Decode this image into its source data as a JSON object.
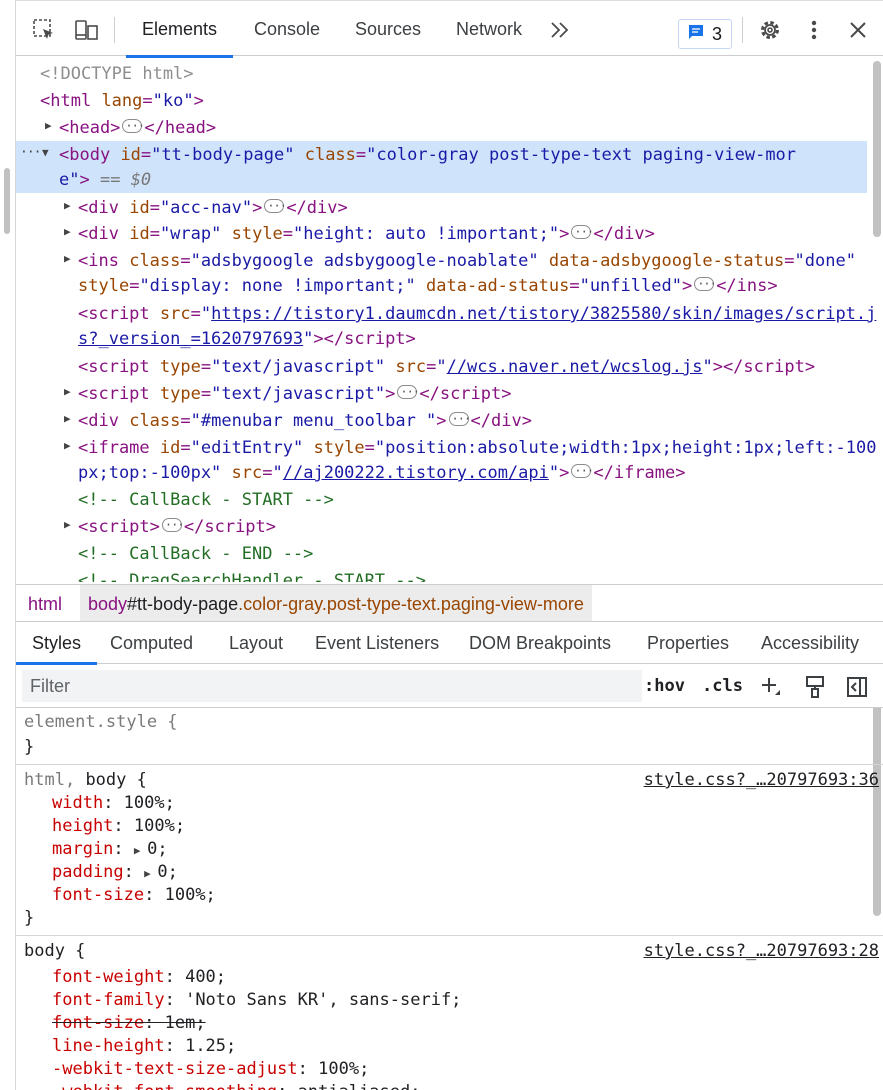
{
  "toolbar": {
    "tabs": [
      {
        "label": "Elements",
        "active": true
      },
      {
        "label": "Console",
        "active": false
      },
      {
        "label": "Sources",
        "active": false
      },
      {
        "label": "Network",
        "active": false
      }
    ],
    "more_label": ">>",
    "issues_count": "3",
    "icons": [
      "inspect-element-icon",
      "device-toggle-icon",
      "chevron-double-right-icon",
      "message-icon",
      "gear-icon",
      "kebab-menu-icon",
      "close-icon"
    ]
  },
  "dom": {
    "doctype": "<!DOCTYPE html>",
    "html_open": "<html",
    "html_lang_attr": "lang",
    "html_lang_val": "\"ko\"",
    "head_open": "<head>",
    "head_close": "</head>",
    "body_open": "<body",
    "body_id_attr": "id",
    "body_id_val": "\"tt-body-page\"",
    "body_class_attr": "class",
    "body_class_val_1": "\"color-gray post-type-text paging-view-mor",
    "body_class_val_2": "e\"",
    "body_eq": "== $0",
    "acc_nav_attr": "id",
    "acc_nav_val": "\"acc-nav\"",
    "wrap_id_val": "\"wrap\"",
    "wrap_style_val": "\"height: auto !important;\"",
    "ins_class_val": "\"adsbygoogle adsbygoogle-noablate\"",
    "ins_status_attr": "data-adsbygoogle-status",
    "ins_status_val": "\"done\"",
    "ins_style_val": "\"display: none !important;\"",
    "ins_ad_attr": "data-ad-status",
    "ins_ad_val": "\"unfilled\"",
    "script1_src_1": "https://tistory1.daumcdn.net/tistory/3825580/skin/images/script.j",
    "script1_src_2": "s?_version_=1620797693",
    "script2_type_val": "\"text/javascript\"",
    "script2_src": "//wcs.naver.net/wcslog.js",
    "script3_type_val": "\"text/javascript\"",
    "menubar_class_val": "\"#menubar menu_toolbar \"",
    "iframe_id_val": "\"editEntry\"",
    "iframe_style_1": "\"position:absolute;width:1px;height:1px;left:-100",
    "iframe_style_2": "px;top:-100px\"",
    "iframe_src": "//aj200222.tistory.com/api",
    "comment_callback_start": "<!-- CallBack - START -->",
    "comment_callback_end": "<!-- CallBack - END -->",
    "comment_drag": "<!-- DragSearchHandler - START -->"
  },
  "breadcrumb": {
    "html": "html",
    "body_tag": "body",
    "body_id": "#tt-body-page",
    "body_classes": ".color-gray.post-type-text.paging-view-more"
  },
  "subtabs": [
    "Styles",
    "Computed",
    "Layout",
    "Event Listeners",
    "DOM Breakpoints",
    "Properties",
    "Accessibility"
  ],
  "filter": {
    "placeholder": "Filter",
    "hov": ":hov",
    "cls": ".cls",
    "icons": [
      "plus-icon",
      "paint-format-icon",
      "sidebar-toggle-icon"
    ]
  },
  "styles": {
    "element_style": {
      "selector": "element.style {",
      "close": "}"
    },
    "rule1": {
      "selector_dim": "html,",
      "selector": "body {",
      "source": "style.css?_…20797693:36",
      "props": [
        {
          "name": "width",
          "value": "100%;"
        },
        {
          "name": "height",
          "value": "100%;"
        },
        {
          "name": "margin",
          "value": "0;"
        },
        {
          "name": "padding",
          "value": "0;"
        },
        {
          "name": "font-size",
          "value": "100%;"
        }
      ],
      "close": "}"
    },
    "rule2": {
      "selector": "body {",
      "source": "style.css?_…20797693:28",
      "props": [
        {
          "name": "font-weight",
          "value": "400;"
        },
        {
          "name": "font-family",
          "value": "'Noto Sans KR', sans-serif;"
        },
        {
          "name": "font-size",
          "value": "1em;"
        },
        {
          "name": "line-height",
          "value": "1.25;"
        },
        {
          "name": "-webkit-text-size-adjust",
          "value": "100%;"
        },
        {
          "name": "-webkit-font-smoothing",
          "value": "antialiased;"
        }
      ]
    }
  }
}
